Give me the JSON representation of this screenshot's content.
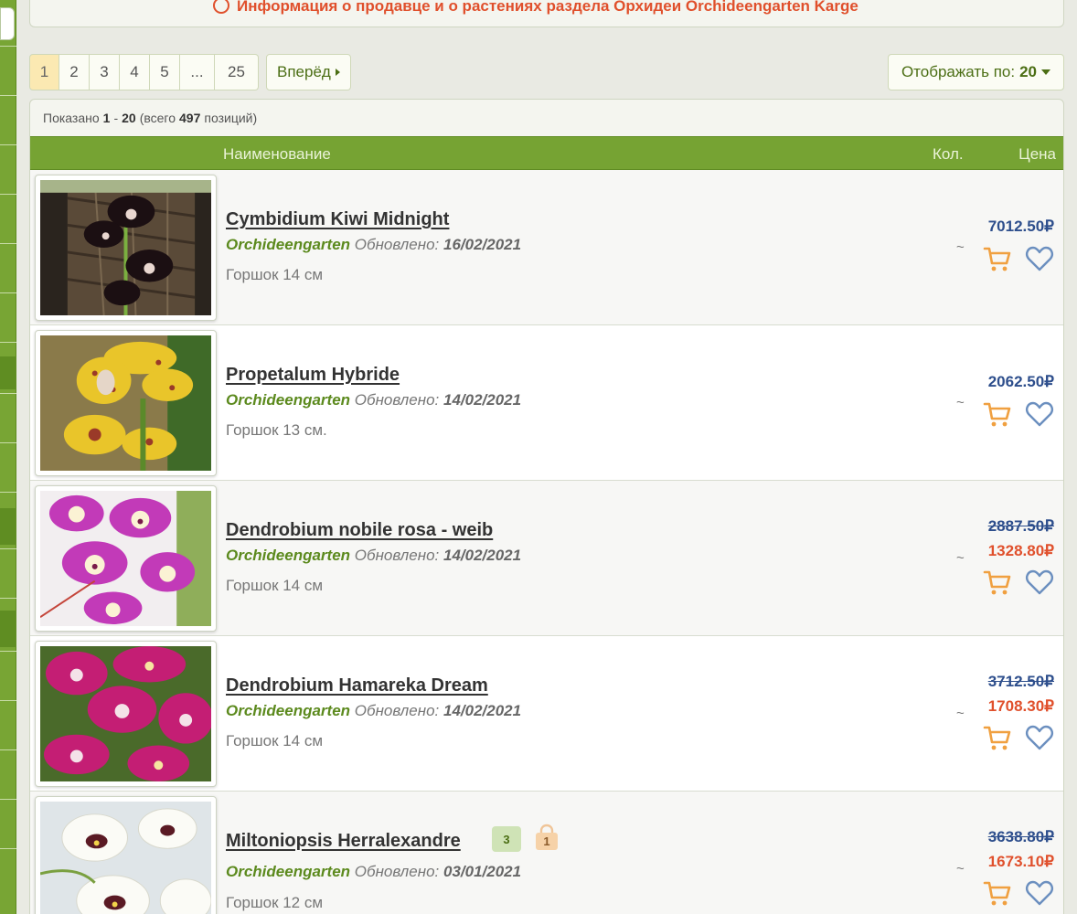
{
  "notice": {
    "text": "Информация о продавце и о растениях раздела Орхидеи Orchideengarten Karge"
  },
  "pagination": {
    "pages": [
      "1",
      "2",
      "3",
      "4",
      "5",
      "...",
      "25"
    ],
    "active": "1",
    "next_label": "Вперёд"
  },
  "perpage": {
    "label": "Отображать по:",
    "value": "20"
  },
  "summary": {
    "prefix": "Показано",
    "from": "1",
    "sep": "-",
    "to": "20",
    "total_prefix": "(всего",
    "total": "497",
    "total_suffix": "позиций)"
  },
  "table": {
    "col_name": "Наименование",
    "col_qty": "Кол.",
    "col_price": "Цена"
  },
  "labels": {
    "updated": "Обновлено:",
    "tilde": "~"
  },
  "products": [
    {
      "title": "Cymbidium Kiwi Midnight",
      "seller": "Orchideengarten",
      "date": "16/02/2021",
      "desc": "Горшок 14 см",
      "price": "7012.50₽",
      "old_price": "",
      "badge_count": "",
      "bag_count": ""
    },
    {
      "title": "Propetalum Hybride",
      "seller": "Orchideengarten",
      "date": "14/02/2021",
      "desc": "Горшок 13 см.",
      "price": "2062.50₽",
      "old_price": "",
      "badge_count": "",
      "bag_count": ""
    },
    {
      "title": "Dendrobium nobile rosa - weib",
      "seller": "Orchideengarten",
      "date": "14/02/2021",
      "desc": "Горшок 14 см",
      "price": "1328.80₽",
      "old_price": "2887.50₽",
      "badge_count": "",
      "bag_count": ""
    },
    {
      "title": "Dendrobium Hamareka Dream",
      "seller": "Orchideengarten",
      "date": "14/02/2021",
      "desc": "Горшок 14 см",
      "price": "1708.30₽",
      "old_price": "3712.50₽",
      "badge_count": "",
      "bag_count": ""
    },
    {
      "title": "Miltoniopsis Herralexandre",
      "seller": "Orchideengarten",
      "date": "03/01/2021",
      "desc": "Горшок 12 см",
      "price": "1673.10₽",
      "old_price": "3638.80₽",
      "badge_count": "3",
      "bag_count": "1"
    }
  ],
  "colors": {
    "green": "#76a333",
    "price_blue": "#2d4e8c",
    "sale_red": "#e0502c",
    "cart_orange": "#f0a040",
    "heart_blue": "#6b8fbf"
  }
}
